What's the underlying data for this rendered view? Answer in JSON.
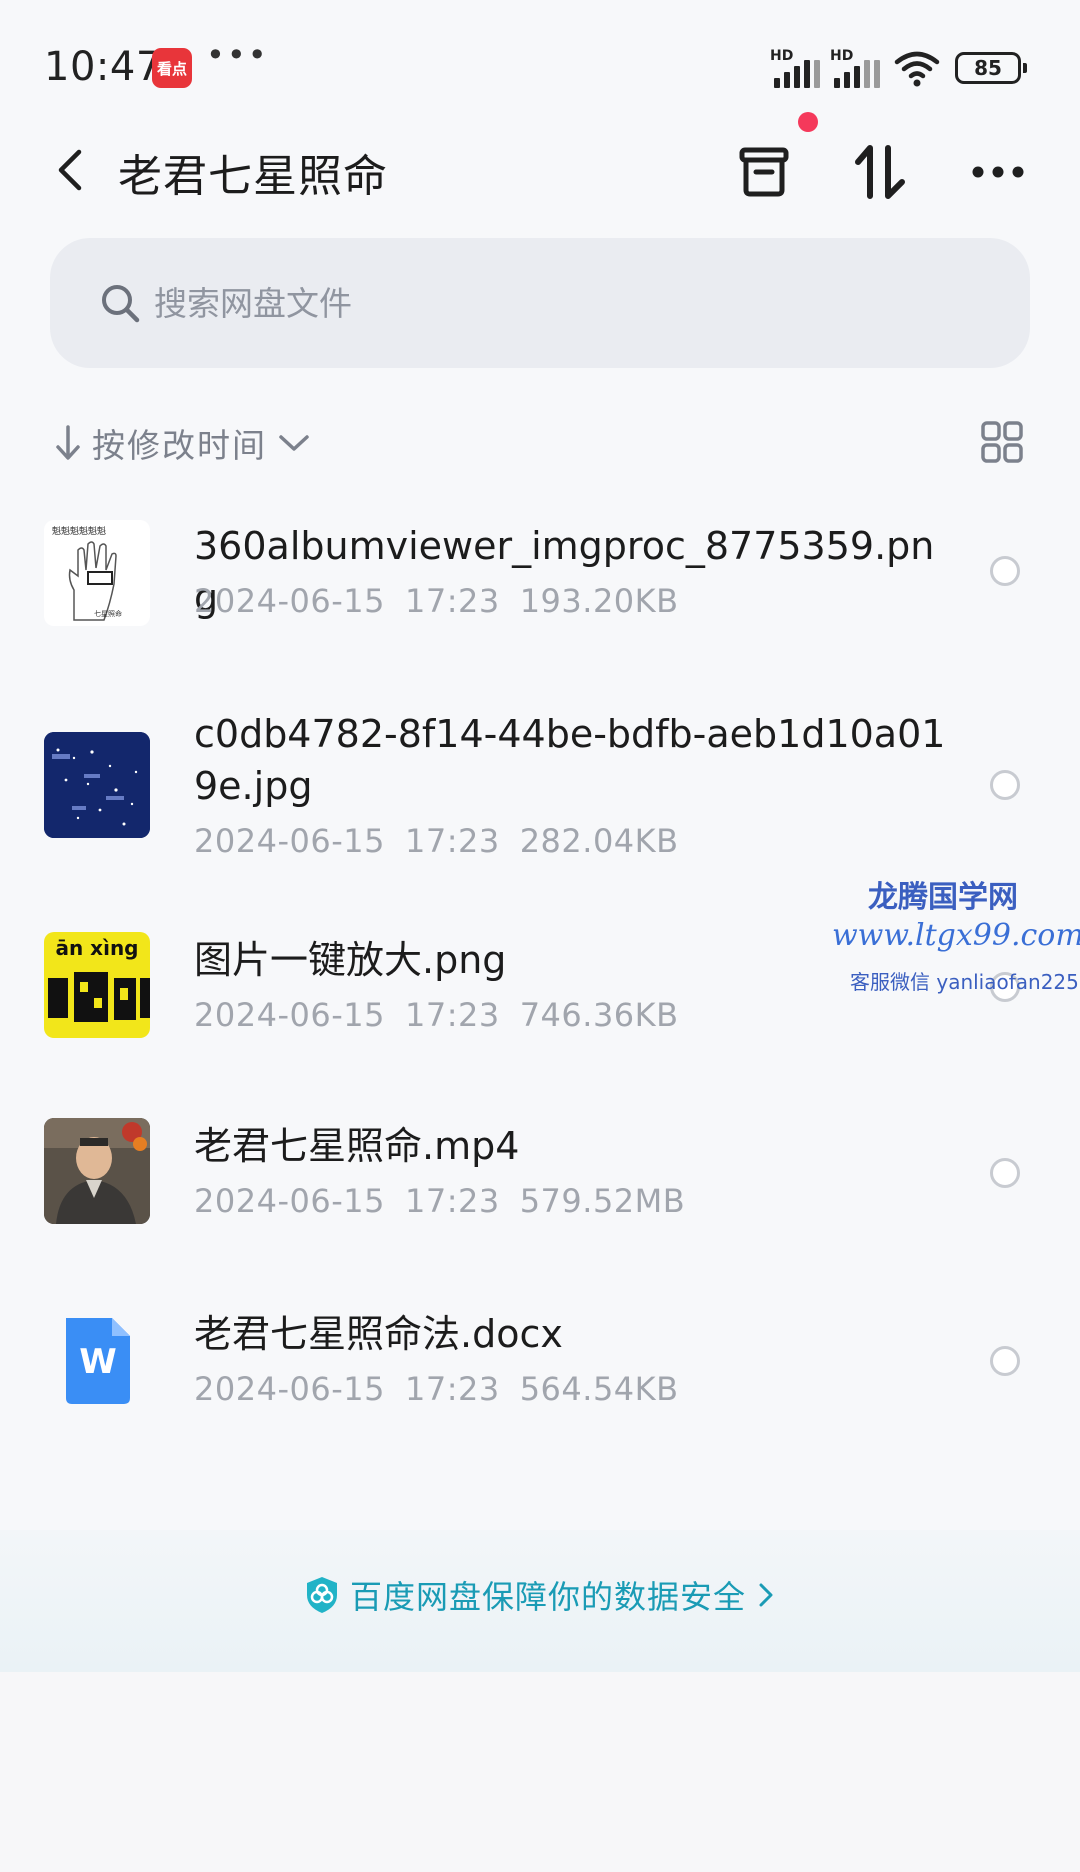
{
  "status_bar": {
    "time": "10:47",
    "app_badge": "看点",
    "more": "•••",
    "signal_1_label": "HD",
    "signal_2_label": "HD",
    "battery": "85"
  },
  "header": {
    "title": "老君七星照命",
    "icons": [
      "back-icon",
      "archive-icon",
      "transfer-icon",
      "more-icon"
    ],
    "notification_dot_color": "#f5395b"
  },
  "search": {
    "placeholder": "搜索网盘文件"
  },
  "sort": {
    "label": "按修改时间"
  },
  "files": [
    {
      "name": "360albumviewer_imgproc_8775359.png",
      "date": "2024-06-15",
      "time": "17:23",
      "size": "193.20KB",
      "thumb": "hand-diagram"
    },
    {
      "name": "c0db4782-8f14-44be-bdfb-aeb1d10a019e.jpg",
      "date": "2024-06-15",
      "time": "17:23",
      "size": "282.04KB",
      "thumb": "star-map"
    },
    {
      "name": "图片一键放大.png",
      "date": "2024-06-15",
      "time": "17:23",
      "size": "746.36KB",
      "thumb": "yellow-calligraphy",
      "thumb_text": "ān xìng"
    },
    {
      "name": "老君七星照命.mp4",
      "date": "2024-06-15",
      "time": "17:23",
      "size": "579.52MB",
      "thumb": "person-video"
    },
    {
      "name": "老君七星照命法.docx",
      "date": "2024-06-15",
      "time": "17:23",
      "size": "564.54KB",
      "thumb": "word-doc",
      "thumb_text": "W"
    }
  ],
  "watermark": {
    "title": "龙腾国学网",
    "url": "www.ltgx99.com",
    "contact": "客服微信 yanliaofan225"
  },
  "security": {
    "text": "百度网盘保障你的数据安全",
    "color": "#1a9bb5"
  }
}
